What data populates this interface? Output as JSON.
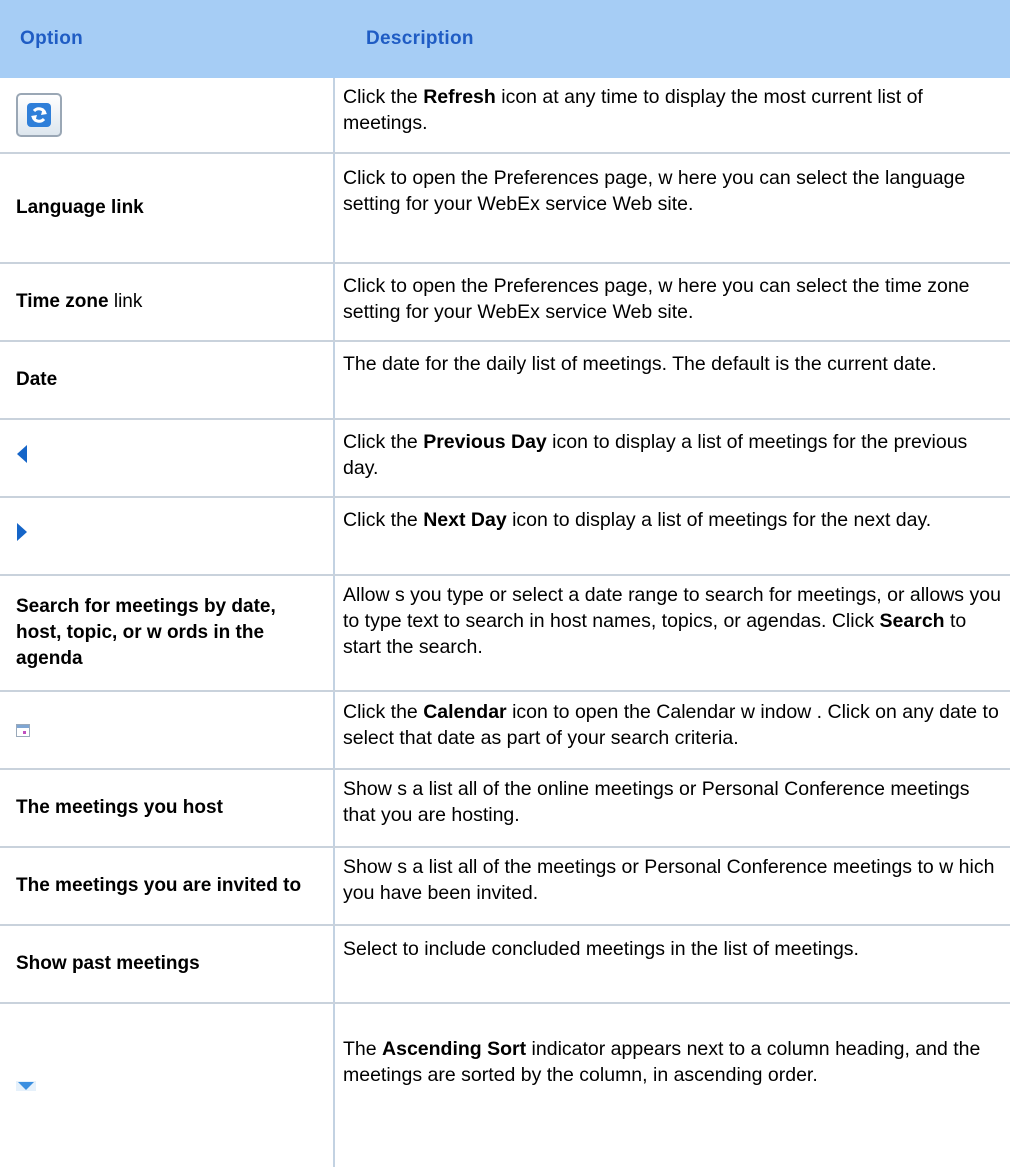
{
  "header": {
    "option": "Option",
    "description": "Description"
  },
  "rows": [
    {
      "icon": "refresh-icon",
      "desc": [
        "Click the ",
        {
          "b": "Refresh"
        },
        " icon at any time to display the most current list of meetings."
      ]
    },
    {
      "option": [
        {
          "b": "Language link"
        }
      ],
      "desc": [
        "Click to open the Preferences page, w here you can select the language setting for your WebEx service Web site."
      ]
    },
    {
      "option": [
        {
          "b": "Time zone"
        },
        " link"
      ],
      "desc": [
        "Click to open the Preferences page, w here you can select the time zone setting for your WebEx service Web site."
      ]
    },
    {
      "option": [
        {
          "b": "Date"
        }
      ],
      "desc": [
        "The date for the daily list of meetings. The default is the current date."
      ]
    },
    {
      "icon": "previous-day-icon",
      "desc": [
        "Click the ",
        {
          "b": "Previous Day"
        },
        " icon to display a list of meetings for the previous day."
      ]
    },
    {
      "icon": "next-day-icon",
      "desc": [
        "Click the ",
        {
          "b": "Next Day"
        },
        " icon to display a list of meetings for the next day."
      ]
    },
    {
      "option": [
        {
          "b": "Search for meetings by date, host, topic, or w ords in the agenda"
        }
      ],
      "desc": [
        "Allow s you type or select a date range to search for meetings, or allows you to type text to search in host names, topics, or agendas. Click ",
        {
          "b": "Search"
        },
        " to start the search."
      ]
    },
    {
      "icon": "calendar-icon",
      "desc": [
        "Click the ",
        {
          "b": "Calendar"
        },
        " icon to open the Calendar w indow . Click on any date to select that date as part of your search criteria."
      ]
    },
    {
      "option": [
        {
          "b": "The meetings you host"
        }
      ],
      "desc": [
        "Show s a list all of the online meetings or Personal Conference meetings that you are hosting."
      ]
    },
    {
      "option": [
        {
          "b": "The meetings you are invited to"
        }
      ],
      "desc": [
        "Show s a list all of the meetings or Personal Conference meetings to w hich you have been invited."
      ]
    },
    {
      "option": [
        {
          "b": "Show past meetings"
        }
      ],
      "desc": [
        "Select to include concluded meetings in the list of meetings."
      ]
    },
    {
      "icon": "ascending-sort-icon",
      "desc": [
        "The ",
        {
          "b": "Ascending Sort"
        },
        " indicator appears next to a column heading, and the meetings are sorted by the column, in ascending order."
      ]
    }
  ],
  "colors": {
    "header_bg": "#a6cdf5",
    "header_text": "#1f5cc4",
    "arrow_blue": "#1565c8"
  }
}
